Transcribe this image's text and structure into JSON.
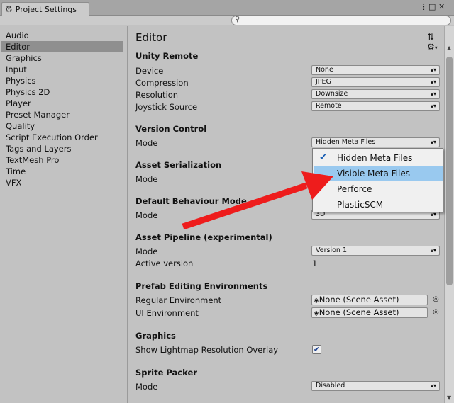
{
  "window": {
    "tab_title": "Project Settings",
    "controls": [
      "⋮",
      "□",
      "✕"
    ]
  },
  "sidebar": {
    "items": [
      {
        "label": "Audio"
      },
      {
        "label": "Editor"
      },
      {
        "label": "Graphics"
      },
      {
        "label": "Input"
      },
      {
        "label": "Physics"
      },
      {
        "label": "Physics 2D"
      },
      {
        "label": "Player"
      },
      {
        "label": "Preset Manager"
      },
      {
        "label": "Quality"
      },
      {
        "label": "Script Execution Order"
      },
      {
        "label": "Tags and Layers"
      },
      {
        "label": "TextMesh Pro"
      },
      {
        "label": "Time"
      },
      {
        "label": "VFX"
      }
    ],
    "selected": "Editor"
  },
  "main": {
    "title": "Editor",
    "unity_remote": {
      "header": "Unity Remote",
      "device_label": "Device",
      "device_value": "None",
      "compression_label": "Compression",
      "compression_value": "JPEG",
      "resolution_label": "Resolution",
      "resolution_value": "Downsize",
      "joystick_label": "Joystick Source",
      "joystick_value": "Remote"
    },
    "version_control": {
      "header": "Version Control",
      "mode_label": "Mode",
      "mode_value": "Hidden Meta Files"
    },
    "asset_serialization": {
      "header": "Asset Serialization",
      "mode_label": "Mode"
    },
    "default_behaviour": {
      "header": "Default Behaviour Mode",
      "mode_label": "Mode",
      "mode_value": "3D"
    },
    "asset_pipeline": {
      "header": "Asset Pipeline (experimental)",
      "mode_label": "Mode",
      "mode_value": "Version 1",
      "active_label": "Active version",
      "active_value": "1"
    },
    "prefab": {
      "header": "Prefab Editing Environments",
      "regular_label": "Regular Environment",
      "regular_value": "None (Scene Asset)",
      "ui_label": "UI Environment",
      "ui_value": "None (Scene Asset)"
    },
    "graphics": {
      "header": "Graphics",
      "lightmap_label": "Show Lightmap Resolution Overlay",
      "lightmap_checked": true
    },
    "sprite_packer": {
      "header": "Sprite Packer",
      "mode_label": "Mode",
      "mode_value": "Disabled"
    }
  },
  "popup": {
    "items": [
      {
        "label": "Hidden Meta Files",
        "checked": true
      },
      {
        "label": "Visible Meta Files",
        "highlighted": true
      },
      {
        "label": "Perforce"
      },
      {
        "label": "PlasticSCM"
      }
    ]
  },
  "colors": {
    "accent_arrow": "#ee1c1c",
    "highlight": "#99c9ef",
    "selected_sidebar": "#8f8f8f"
  }
}
